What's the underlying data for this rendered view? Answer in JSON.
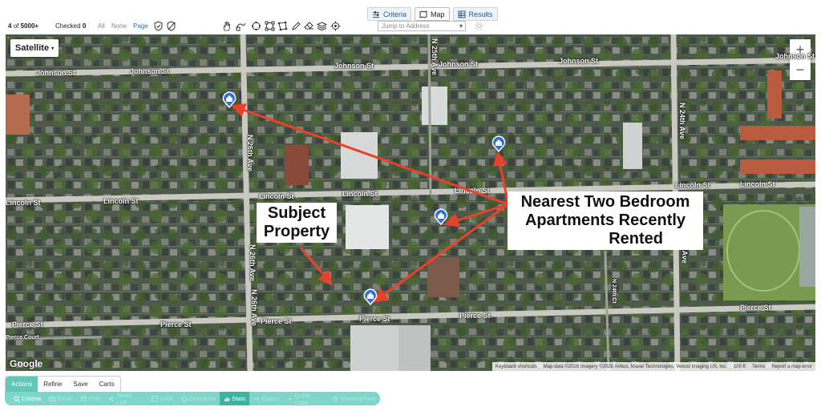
{
  "view_tabs": [
    {
      "label": "Criteria",
      "icon": "sliders-icon"
    },
    {
      "label": "Map",
      "icon": "map-icon"
    },
    {
      "label": "Results",
      "icon": "grid-icon"
    }
  ],
  "toolbar": {
    "position": "4",
    "of_label": "of",
    "total": "5000+",
    "checked_label": "Checked",
    "checked_count": "0",
    "all": "All",
    "none": "None",
    "page": "Page",
    "jump_placeholder": "Jump to Address",
    "map_tools": [
      "pan-hand-icon",
      "draw-shape-icon",
      "circle-tool-icon",
      "rectangle-tool-icon",
      "polygon-tool-icon",
      "pencil-icon",
      "eraser-icon",
      "layers-icon",
      "location-target-icon"
    ]
  },
  "map": {
    "type_button": "Satellite",
    "zoom_in": "+",
    "zoom_out": "−",
    "streets": {
      "johnson_left": "Johnson St",
      "johnson_mid": "Johnson St",
      "johnson_right": "Johnson St",
      "lincoln_left": "Lincoln St",
      "lincoln_mid1": "Lincoln St",
      "lincoln_mid2": "Lincoln St",
      "lincoln_mid3": "Lincoln St",
      "lincoln_right": "Lincoln St",
      "pierce_left": "Pierce St",
      "pierce_mid1": "Pierce St",
      "pierce_mid2": "Pierce St",
      "pierce_right": "Pierce St",
      "n26_top": "N 26th Ave",
      "n26_mid": "N 26th Ave",
      "n26_bot": "N 26th Ave",
      "n24_top": "N 24th Ave",
      "n24_bot": "N 24th Ave",
      "n25": "N 25th Ave",
      "n24_court": "N 24th Ct",
      "pierce_court": "Pierce Court"
    },
    "callout_subject": "Subject Property",
    "callout_apartments_line1": "Nearest Two Bedroom",
    "callout_apartments_line2": "Apartments Recently",
    "callout_apartments_line3": "Rented",
    "google_logo": "Google",
    "attribution": {
      "shortcuts": "Keyboard shortcuts",
      "data": "Map data ©2026 Imagery ©2026 Airbus, Maxar Technologies, Vexcel Imaging US, Inc.",
      "scale": "100 ft",
      "terms": "Terms",
      "report": "Report a map error"
    },
    "arrow_color": "#e8432a",
    "pin_color": "#2f6fd6"
  },
  "bottom": {
    "tabs": [
      "Actions",
      "Refine",
      "Save",
      "Carts"
    ],
    "actions": [
      {
        "label": "Criteria",
        "icon": "criteria-icon",
        "active": true
      },
      {
        "label": "Email",
        "icon": "email-icon",
        "active": false
      },
      {
        "label": "Print",
        "icon": "print-icon",
        "active": false
      },
      {
        "label": "Share Link",
        "icon": "share-icon",
        "active": false
      },
      {
        "label": "CMA",
        "icon": "cma-icon",
        "active": false
      },
      {
        "label": "Directions",
        "icon": "directions-icon",
        "active": false
      },
      {
        "label": "Stats",
        "icon": "stats-icon",
        "active": true
      },
      {
        "label": "Export",
        "icon": "export-icon",
        "active": false
      },
      {
        "label": "Quick CMA",
        "icon": "quick-cma-icon",
        "active": false
      },
      {
        "label": "ShowingTime",
        "icon": "showingtime-icon",
        "active": false
      }
    ],
    "accent": "#7ed6c8"
  }
}
